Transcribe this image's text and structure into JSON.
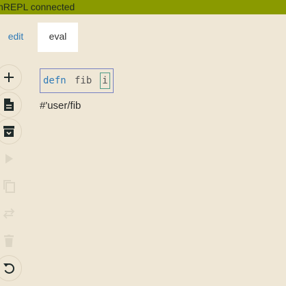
{
  "status": {
    "text": "nREPL connected",
    "color": "#8a9a00"
  },
  "tabs": [
    {
      "label": "edit",
      "active": false
    },
    {
      "label": "eval",
      "active": true
    }
  ],
  "toolbar": {
    "items": [
      {
        "icon": "plus-icon",
        "action": "add",
        "enabled": true
      },
      {
        "icon": "document-icon",
        "action": "file",
        "enabled": true
      },
      {
        "icon": "archive-icon",
        "action": "archive",
        "enabled": true
      },
      {
        "icon": "play-icon",
        "action": "run",
        "enabled": false
      },
      {
        "icon": "copy-icon",
        "action": "copy",
        "enabled": false
      },
      {
        "icon": "swap-icon",
        "action": "swap",
        "enabled": false
      },
      {
        "icon": "trash-icon",
        "action": "delete",
        "enabled": false
      },
      {
        "icon": "undo-icon",
        "action": "undo",
        "enabled": true
      }
    ]
  },
  "editor": {
    "keyword": "defn",
    "name": "fib",
    "cursor_token": "i"
  },
  "result": {
    "text": "#'user/fib"
  },
  "colors": {
    "background": "#efe7d6",
    "keyword": "#2f7ab7",
    "selection_border": "#7480c2",
    "cursor_border": "#4e9a86"
  }
}
